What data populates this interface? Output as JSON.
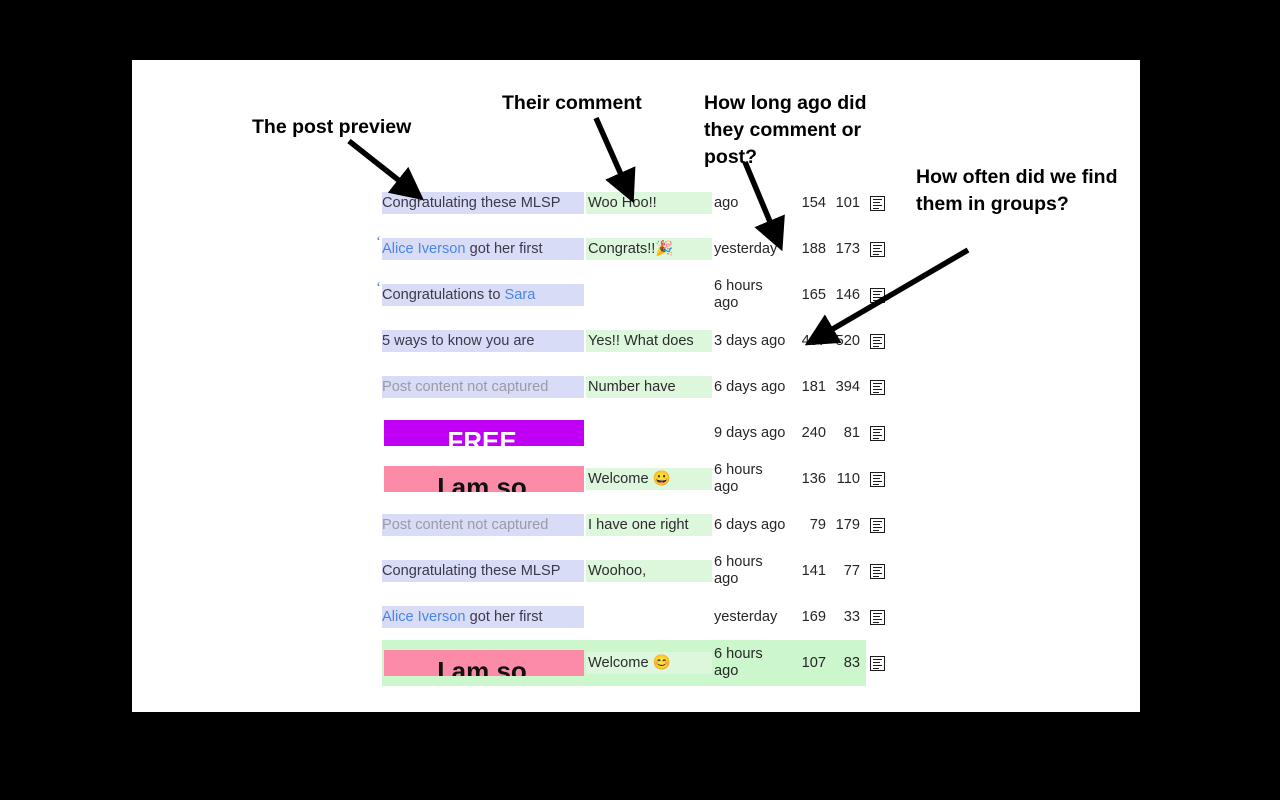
{
  "annotations": [
    {
      "id": "post-preview",
      "text": "The post preview"
    },
    {
      "id": "their-comment",
      "text": "Their comment"
    },
    {
      "id": "how-long-ago",
      "text": "How long ago did they comment or post?"
    },
    {
      "id": "how-often",
      "text": "How often did we find them in groups?"
    }
  ],
  "table": {
    "rows": [
      {
        "preview_text": "Congratulating these MLSP",
        "preview_kind": "text",
        "comment": "Woo Hoo!!",
        "time": "ago",
        "count_1": "154",
        "count_2": "101",
        "icon": "document-list-icon",
        "selected": false,
        "marker": ""
      },
      {
        "preview_text": "Alice Iverson got her first",
        "preview_person": "Alice Iverson",
        "preview_rest": " got her first",
        "preview_kind": "text-person",
        "comment": "Congrats!!🎉",
        "time": "yesterday",
        "count_1": "188",
        "count_2": "173",
        "icon": "document-list-icon",
        "selected": false,
        "marker": "‘"
      },
      {
        "preview_text": "Congratulations to Sara",
        "preview_person": "Sara",
        "preview_rest": "Congratulations to ",
        "preview_kind": "text-person-suffix",
        "comment": "",
        "time": "6 hours ago",
        "count_1": "165",
        "count_2": "146",
        "icon": "document-list-icon",
        "selected": false,
        "marker": "‘"
      },
      {
        "preview_text": "5 ways to know you are",
        "preview_kind": "text",
        "comment": "Yes!! What does",
        "time": "3 days ago",
        "count_1": "407",
        "count_2": "520",
        "icon": "document-list-icon",
        "selected": false,
        "marker": ""
      },
      {
        "preview_text": "Post content not captured",
        "preview_kind": "placeholder",
        "comment": "Number have",
        "time": "6 days ago",
        "count_1": "181",
        "count_2": "394",
        "icon": "document-list-icon",
        "selected": false,
        "marker": ""
      },
      {
        "preview_text": "FREE",
        "preview_kind": "thumb-magenta",
        "comment": "",
        "time": "9 days ago",
        "count_1": "240",
        "count_2": "81",
        "icon": "document-list-icon",
        "selected": false,
        "marker": ""
      },
      {
        "preview_text": "I am so",
        "preview_kind": "thumb-pink",
        "comment": "Welcome 😀",
        "time": "6 hours ago",
        "count_1": "136",
        "count_2": "110",
        "icon": "document-list-icon",
        "selected": false,
        "marker": ""
      },
      {
        "preview_text": "Post content not captured",
        "preview_kind": "placeholder",
        "comment": "I have one right",
        "time": "6 days ago",
        "count_1": "79",
        "count_2": "179",
        "icon": "document-list-icon",
        "selected": false,
        "marker": ""
      },
      {
        "preview_text": "Congratulating these MLSP",
        "preview_kind": "text",
        "comment": "Woohoo,",
        "time": "6 hours ago",
        "count_1": "141",
        "count_2": "77",
        "icon": "document-list-icon",
        "selected": false,
        "marker": ""
      },
      {
        "preview_text": "Alice Iverson got her first",
        "preview_person": "Alice Iverson",
        "preview_rest": " got her first",
        "preview_kind": "text-person",
        "comment": "",
        "time": "yesterday",
        "count_1": "169",
        "count_2": "33",
        "icon": "document-list-icon",
        "selected": false,
        "marker": ""
      },
      {
        "preview_text": "I am so",
        "preview_kind": "thumb-pink",
        "comment": "Welcome 😊",
        "time": "6 hours ago",
        "count_1": "107",
        "count_2": "83",
        "icon": "document-list-icon",
        "selected": true,
        "marker": ""
      }
    ]
  },
  "colors": {
    "page_background": "#000000",
    "card_background": "#ffffff",
    "preview_highlight": "#d9dcf7",
    "comment_highlight": "#ddf7dd",
    "row_selected": "#ccf7cc",
    "person_link": "#4a86e8",
    "placeholder_text": "#9a9aa8",
    "banner_magenta": "#bf00f5",
    "banner_pink": "#fb8ba6",
    "annotation_text": "#000000"
  }
}
